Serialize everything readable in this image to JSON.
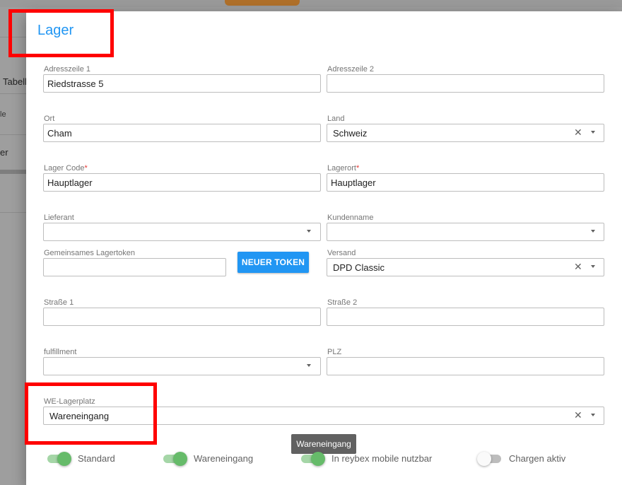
{
  "background": {
    "row_texts": [
      "Tabell",
      "le",
      "er"
    ]
  },
  "dialog": {
    "title": "Lager",
    "fields": {
      "adresszeile1": {
        "label": "Adresszeile 1",
        "value": "Riedstrasse 5"
      },
      "adresszeile2": {
        "label": "Adresszeile 2",
        "value": ""
      },
      "ort": {
        "label": "Ort",
        "value": "Cham"
      },
      "land": {
        "label": "Land",
        "value": "Schweiz"
      },
      "lager_code": {
        "label": "Lager Code",
        "required": "*",
        "value": "Hauptlager"
      },
      "lagerort": {
        "label": "Lagerort",
        "required": "*",
        "value": "Hauptlager"
      },
      "lieferant": {
        "label": "Lieferant",
        "value": ""
      },
      "kundenname": {
        "label": "Kundenname",
        "value": ""
      },
      "lagertoken": {
        "label": "Gemeinsames Lagertoken",
        "value": ""
      },
      "versand": {
        "label": "Versand",
        "value": "DPD Classic"
      },
      "strasse1": {
        "label": "Straße 1",
        "value": ""
      },
      "strasse2": {
        "label": "Straße 2",
        "value": ""
      },
      "fulfillment": {
        "label": "fulfillment",
        "value": ""
      },
      "plz": {
        "label": "PLZ",
        "value": ""
      },
      "we_lagerplatz": {
        "label": "WE-Lagerplatz",
        "value": "Wareneingang"
      }
    },
    "new_token_button": "NEUER TOKEN",
    "tooltip": "Wareneingang",
    "toggles": [
      {
        "label": "Standard",
        "on": true
      },
      {
        "label": "Wareneingang",
        "on": true
      },
      {
        "label": "In reybex mobile nutzbar",
        "on": true
      },
      {
        "label": "Chargen aktiv",
        "on": false
      }
    ]
  },
  "colors": {
    "accent": "#2196f3",
    "toggle_on": "#66bb6a",
    "highlight": "#ff0000",
    "required": "#e53935"
  },
  "icons": {
    "clear": "clear-icon",
    "dropdown": "chevron-down-icon"
  }
}
